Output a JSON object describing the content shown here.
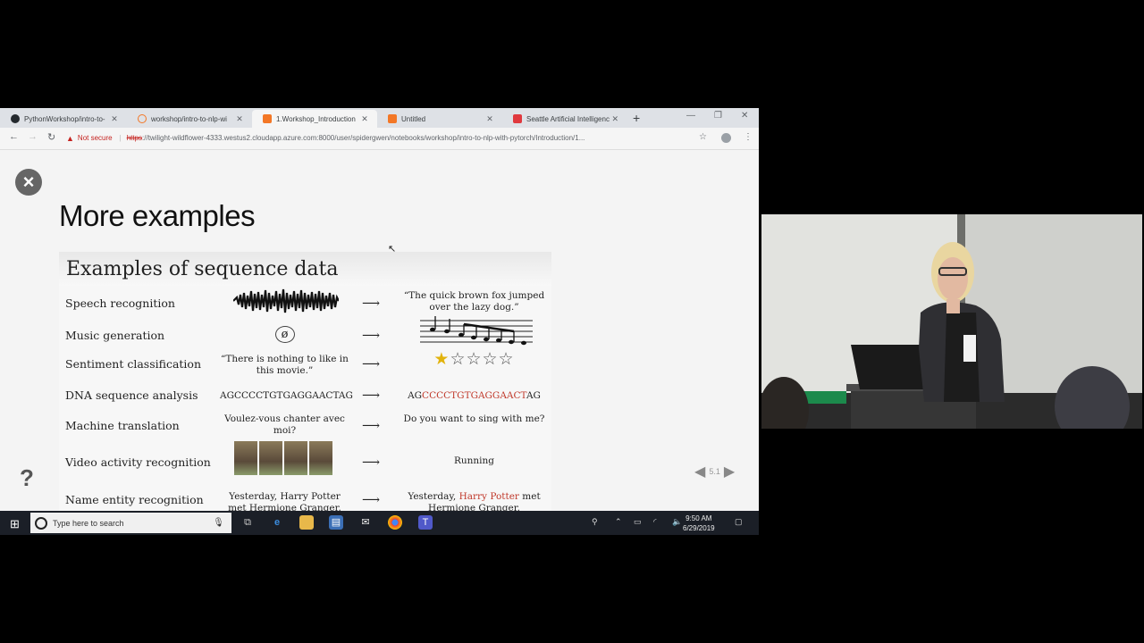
{
  "browser": {
    "tabs": [
      {
        "title": "PythonWorkshop/intro-to-",
        "favicon_color": "#24292e",
        "active": false
      },
      {
        "title": "workshop/intro-to-nlp-wi",
        "favicon_color": "#f37726",
        "active": false
      },
      {
        "title": "1.Workshop_Introduction",
        "favicon_color": "#f37726",
        "active": true
      },
      {
        "title": "Untitled",
        "favicon_color": "#f37726",
        "active": false
      },
      {
        "title": "Seattle Artificial Intelligence",
        "favicon_color": "#e0393e",
        "active": false
      }
    ],
    "security_label": "Not secure",
    "url_scheme": "https",
    "url_rest": "://twilight-wildflower-4333.westus2.cloudapp.azure.com:8000/user/spidergwen/notebooks/workshop/intro-to-nlp-with-pytorch/Introduction/1..."
  },
  "slide": {
    "title": "More examples",
    "help_label": "?",
    "page_indicator": "5.1",
    "image_heading": "Examples of sequence data",
    "rows": [
      {
        "label": "Speech recognition",
        "input": "",
        "output": "“The quick brown fox jumped over the lazy dog.”"
      },
      {
        "label": "Music generation",
        "input": "ø",
        "output": ""
      },
      {
        "label": "Sentiment classification",
        "input": "“There is nothing to like in this movie.”",
        "output": ""
      },
      {
        "label": "DNA sequence analysis",
        "input": "AGCCCCTGTGAGGAACTAG",
        "output_prefix": "AG",
        "output_highlight": "CCCCTGTGAGGAACT",
        "output_suffix": "AG"
      },
      {
        "label": "Machine translation",
        "input": "Voulez-vous chanter avec moi?",
        "output": "Do you want to sing with me?"
      },
      {
        "label": "Video activity recognition",
        "input": "",
        "output": "Running"
      },
      {
        "label": "Name entity recognition",
        "input": "Yesterday, Harry Potter met Hermione Granger.",
        "output_prefix": "Yesterday, ",
        "output_highlight": "Harry Potter",
        "output_suffix": " met Hermione Granger."
      }
    ]
  },
  "taskbar": {
    "search_placeholder": "Type here to search",
    "time": "9:50 AM",
    "date": "6/29/2019"
  }
}
